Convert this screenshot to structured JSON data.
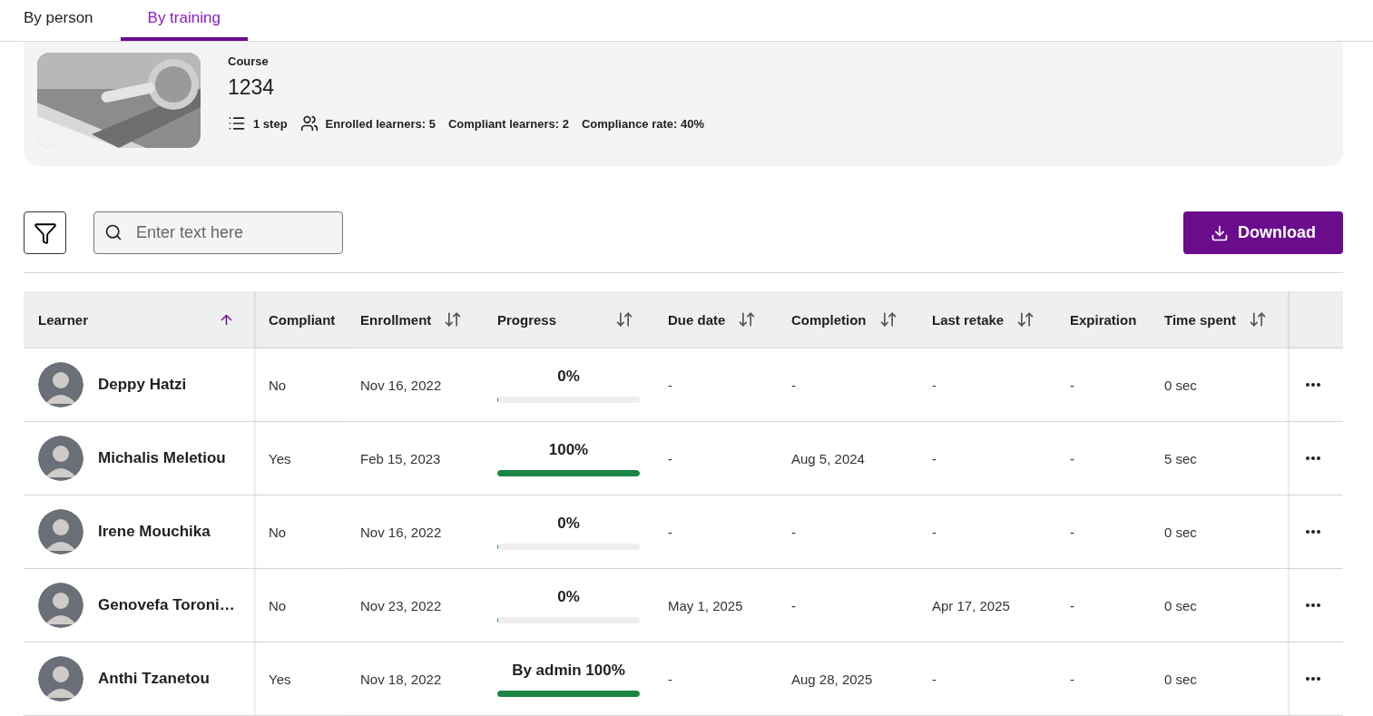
{
  "tabs": [
    {
      "label": "By person",
      "selected": false
    },
    {
      "label": "By training",
      "selected": true
    }
  ],
  "course": {
    "kind": "picture",
    "label": "Course",
    "title": "1234",
    "steps": "1 step",
    "enrolled": "Enrolled learners: 5",
    "compliant": "Compliant learners: 2",
    "rate": "Compliance rate: 40%"
  },
  "search": {
    "placeholder": "Enter text here"
  },
  "download_button": "Download",
  "table": {
    "columns": [
      {
        "label": "Learner",
        "sortable": true,
        "sorted": true
      },
      {
        "label": "Compliant",
        "sortable": false,
        "sorted": false
      },
      {
        "label": "Enrollment",
        "sortable": true,
        "sorted": false
      },
      {
        "label": "Progress",
        "sortable": true,
        "sorted": false
      },
      {
        "label": "Due date",
        "sortable": true,
        "sorted": false
      },
      {
        "label": "Completion",
        "sortable": true,
        "sorted": false
      },
      {
        "label": "Last retake",
        "sortable": true,
        "sorted": false
      },
      {
        "label": "Expiration",
        "sortable": false,
        "sorted": false
      },
      {
        "label": "Time spent",
        "sortable": true,
        "sorted": false
      }
    ],
    "rows": [
      {
        "name": "Deppy Hatzi",
        "compliant": "No",
        "enrollment": "Nov 16, 2022",
        "progress": "0%",
        "level": 0,
        "due": "-",
        "completion": "-",
        "retake": "-",
        "expiration": "-",
        "time": "0 sec"
      },
      {
        "name": "Michalis Meletiou",
        "compliant": "Yes",
        "enrollment": "Feb 15, 2023",
        "progress": "100%",
        "level": 1,
        "due": "-",
        "completion": "Aug 5, 2024",
        "retake": "-",
        "expiration": "-",
        "time": "5 sec"
      },
      {
        "name": "Irene Mouchika",
        "compliant": "No",
        "enrollment": "Nov 16, 2022",
        "progress": "0%",
        "level": 0,
        "due": "-",
        "completion": "-",
        "retake": "-",
        "expiration": "-",
        "time": "0 sec"
      },
      {
        "name": "Genovefa Toroni…",
        "compliant": "No",
        "enrollment": "Nov 23, 2022",
        "progress": "0%",
        "level": 0,
        "due": "May 1, 2025",
        "completion": "-",
        "retake": "Apr 17, 2025",
        "expiration": "-",
        "time": "0 sec"
      },
      {
        "name": "Anthi Tzanetou",
        "compliant": "Yes",
        "enrollment": "Nov 18, 2022",
        "progress": "By admin 100%",
        "level": 1,
        "due": "-",
        "completion": "Aug 28, 2025",
        "retake": "-",
        "expiration": "-",
        "time": "0 sec"
      }
    ]
  }
}
